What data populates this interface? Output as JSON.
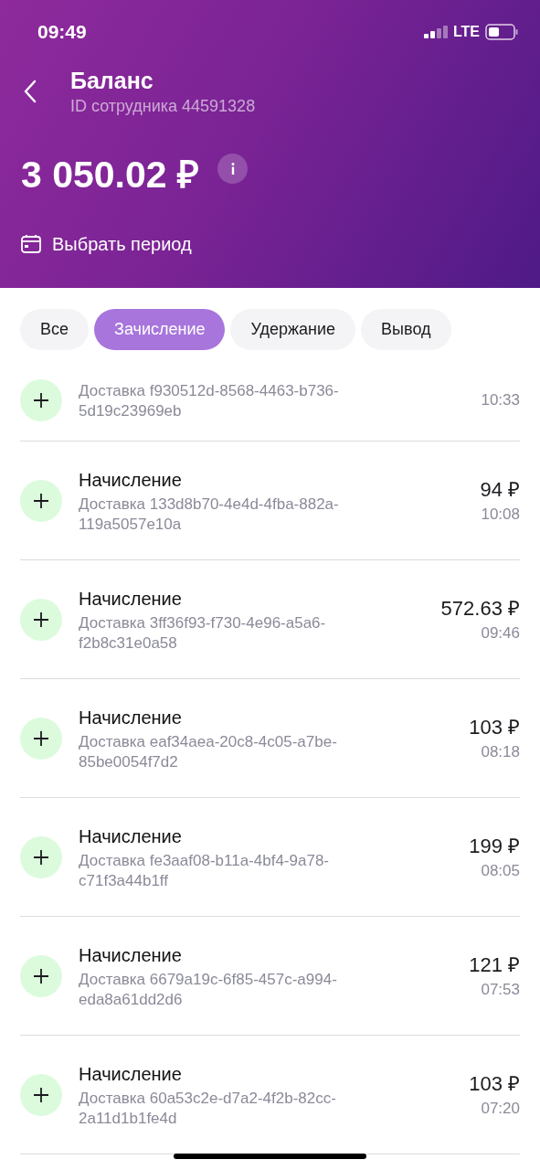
{
  "status_bar": {
    "time": "09:49",
    "network": "LTE"
  },
  "header": {
    "title": "Баланс",
    "subtitle": "ID сотрудника 44591328",
    "balance": "3 050.02 ₽",
    "period_button": "Выбрать период"
  },
  "tabs": [
    {
      "label": "Все",
      "selected": false
    },
    {
      "label": "Зачисление",
      "selected": true
    },
    {
      "label": "Удержание",
      "selected": false
    },
    {
      "label": "Вывод",
      "selected": false
    }
  ],
  "transactions": [
    {
      "description": "Доставка f930512d-8568-4463-b736-5d19c23969eb",
      "time": "10:33"
    },
    {
      "title": "Начисление",
      "description": "Доставка 133d8b70-4e4d-4fba-882a-119a5057e10a",
      "amount": "94 ₽",
      "time": "10:08"
    },
    {
      "title": "Начисление",
      "description": "Доставка 3ff36f93-f730-4e96-a5a6-f2b8c31e0a58",
      "amount": "572.63 ₽",
      "time": "09:46"
    },
    {
      "title": "Начисление",
      "description": "Доставка eaf34aea-20c8-4c05-a7be-85be0054f7d2",
      "amount": "103 ₽",
      "time": "08:18"
    },
    {
      "title": "Начисление",
      "description": "Доставка fe3aaf08-b11a-4bf4-9a78-c71f3a44b1ff",
      "amount": "199 ₽",
      "time": "08:05"
    },
    {
      "title": "Начисление",
      "description": "Доставка 6679a19c-6f85-457c-a994-eda8a61dd2d6",
      "amount": "121 ₽",
      "time": "07:53"
    },
    {
      "title": "Начисление",
      "description": "Доставка 60a53c2e-d7a2-4f2b-82cc-2a11d1b1fe4d",
      "amount": "103 ₽",
      "time": "07:20"
    }
  ]
}
